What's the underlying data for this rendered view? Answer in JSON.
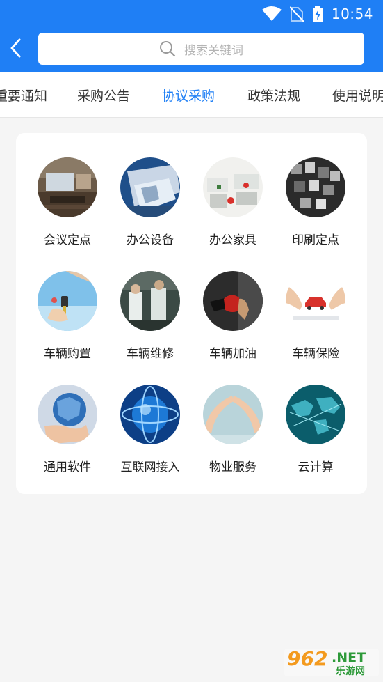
{
  "status_bar": {
    "time": "10:54",
    "icons": [
      "wifi-icon",
      "no-sim-icon",
      "battery-charging-icon"
    ]
  },
  "header": {
    "back_icon": "chevron-left-icon",
    "search": {
      "icon": "search-icon",
      "placeholder": "搜索关键词"
    }
  },
  "tabs": [
    {
      "label": "重要通知"
    },
    {
      "label": "采购公告"
    },
    {
      "label": "协议采购",
      "active": true
    },
    {
      "label": "政策法规"
    },
    {
      "label": "使用说明"
    }
  ],
  "categories": [
    {
      "label": "会议定点",
      "image": "meeting-room-image"
    },
    {
      "label": "办公设备",
      "image": "office-equipment-image"
    },
    {
      "label": "办公家具",
      "image": "office-furniture-image"
    },
    {
      "label": "印刷定点",
      "image": "printing-image"
    },
    {
      "label": "车辆购置",
      "image": "car-key-image"
    },
    {
      "label": "车辆维修",
      "image": "car-repair-image"
    },
    {
      "label": "车辆加油",
      "image": "fuel-nozzle-image"
    },
    {
      "label": "车辆保险",
      "image": "car-insurance-image"
    },
    {
      "label": "通用软件",
      "image": "software-globe-image"
    },
    {
      "label": "互联网接入",
      "image": "internet-globe-image"
    },
    {
      "label": "物业服务",
      "image": "property-hands-image"
    },
    {
      "label": "云计算",
      "image": "cloud-map-image"
    }
  ],
  "watermark": {
    "number": "962",
    "suffix": ".NET",
    "sub": "乐游网"
  },
  "colors": {
    "primary": "#1f7ff5",
    "background": "#f5f5f5",
    "text": "#222222"
  }
}
